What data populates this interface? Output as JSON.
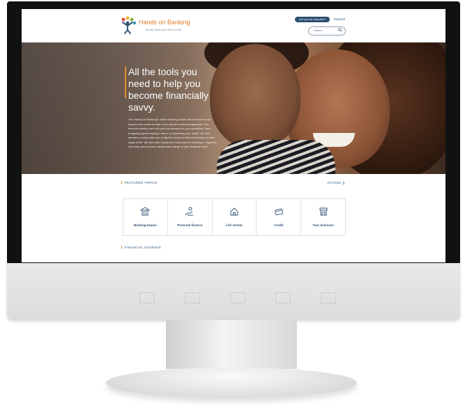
{
  "header": {
    "logo_text": "Hands on Banking",
    "logo_tagline": "Money skills you need for life",
    "educator_button": "Are you an educator?",
    "language_link": "Español",
    "search_placeholder": "Search"
  },
  "hero": {
    "title": "All the tools you need to help you become financially savvy.",
    "body": "The Hands on Banking® online learning center offers resources for anyone who wants to learn more about money management. Our financial articles can help you find answers to your questions, from budgeting tips to buying a home, to improving your credit. Our self-directed courses take you in depth to improve financial literacy at each stage of life. We also offer classroom resources for educators. Together, we'll help you and your family take charge of your financial future."
  },
  "featured": {
    "label": "FEATURED TOPICS",
    "all_articles": "All Articles ❯",
    "topics": [
      {
        "label": "Banking basics",
        "icon": "bank-icon"
      },
      {
        "label": "Personal finance",
        "icon": "hand-coin-icon"
      },
      {
        "label": "Life events",
        "icon": "house-icon"
      },
      {
        "label": "Credit",
        "icon": "credit-card-icon"
      },
      {
        "label": "Your business",
        "icon": "storefront-icon"
      }
    ]
  },
  "courses": {
    "label": "FINANCIAL COURSES"
  },
  "colors": {
    "navy": "#2b4f72",
    "orange_accent": "#e48b2c",
    "link_blue": "#2b6da3"
  }
}
